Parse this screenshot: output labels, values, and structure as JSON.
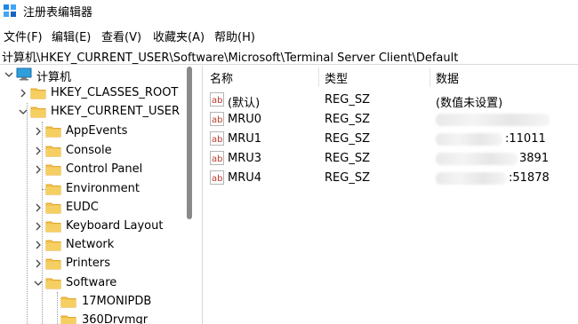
{
  "window": {
    "title": "注册表编辑器"
  },
  "menu": [
    "文件(F)",
    "编辑(E)",
    "查看(V)",
    "收藏夹(A)",
    "帮助(H)"
  ],
  "address": "计算机\\HKEY_CURRENT_USER\\Software\\Microsoft\\Terminal Server Client\\Default",
  "tree": {
    "root": "计算机",
    "hives": [
      "HKEY_CLASSES_ROOT",
      "HKEY_CURRENT_USER"
    ],
    "hkcu_children": [
      "AppEvents",
      "Console",
      "Control Panel",
      "Environment",
      "EUDC",
      "Keyboard Layout",
      "Network",
      "Printers",
      "Software"
    ],
    "software_children": [
      "17MONIPDB",
      "360Drvmgr"
    ]
  },
  "list": {
    "columns": [
      "名称",
      "类型",
      "数据"
    ],
    "rows": [
      {
        "name": "(默认)",
        "type": "REG_SZ",
        "data": "(数值未设置)",
        "redacted": false
      },
      {
        "name": "MRU0",
        "type": "REG_SZ",
        "data": "",
        "redacted": true
      },
      {
        "name": "MRU1",
        "type": "REG_SZ",
        "data": ":11011",
        "redacted": true
      },
      {
        "name": "MRU3",
        "type": "REG_SZ",
        "data": "3891",
        "redacted": true
      },
      {
        "name": "MRU4",
        "type": "REG_SZ",
        "data": ":51878",
        "redacted": true
      }
    ]
  },
  "icons": {
    "app": "regedit-icon",
    "value": "string-value-icon",
    "folder": "folder-icon",
    "computer": "computer-icon"
  },
  "colors": {
    "folder": "#f3c14b",
    "folder_dark": "#e0a72e",
    "value_icon_red": "#c0392b"
  }
}
